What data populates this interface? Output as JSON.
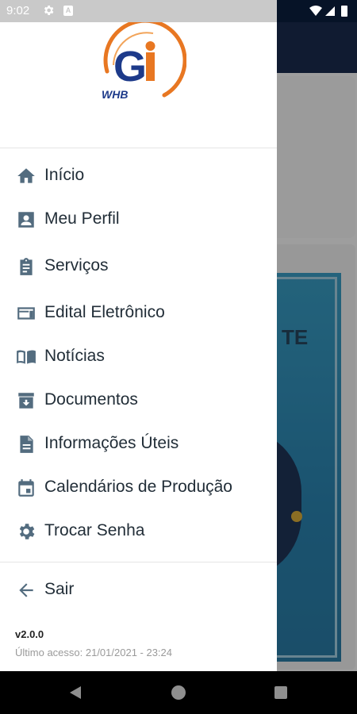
{
  "status_bar": {
    "time": "9:02",
    "icons": [
      "gear-icon",
      "a-notification-icon",
      "wifi-icon",
      "signal-icon",
      "battery-icon"
    ]
  },
  "drawer": {
    "logo": {
      "letters": "Gi",
      "brand": "WHB",
      "colors": {
        "ring": "#e87722",
        "letter_g": "#1d3a8a",
        "letter_i": "#e87722"
      }
    },
    "menu": [
      {
        "label": "Início",
        "icon": "home-icon"
      },
      {
        "label": "Meu Perfil",
        "icon": "profile-card-icon"
      },
      {
        "label": "Serviços",
        "icon": "clipboard-icon"
      },
      {
        "label": "Edital Eletrônico",
        "icon": "card-icon"
      },
      {
        "label": "Notícias",
        "icon": "book-icon"
      },
      {
        "label": "Documentos",
        "icon": "archive-icon"
      },
      {
        "label": "Informações Úteis",
        "icon": "document-icon"
      },
      {
        "label": "Calendários de Produção",
        "icon": "calendar-icon"
      },
      {
        "label": "Trocar Senha",
        "icon": "gear-icon"
      }
    ],
    "logout": {
      "label": "Sair",
      "icon": "arrow-left-icon"
    },
    "version": "v2.0.0",
    "last_access": "Último acesso: 21/01/2021 - 23:24"
  },
  "background": {
    "poster_text": "TE"
  },
  "colors": {
    "icon": "#536c7f",
    "text": "#222e38",
    "app_bar": "#1b2d4f"
  }
}
